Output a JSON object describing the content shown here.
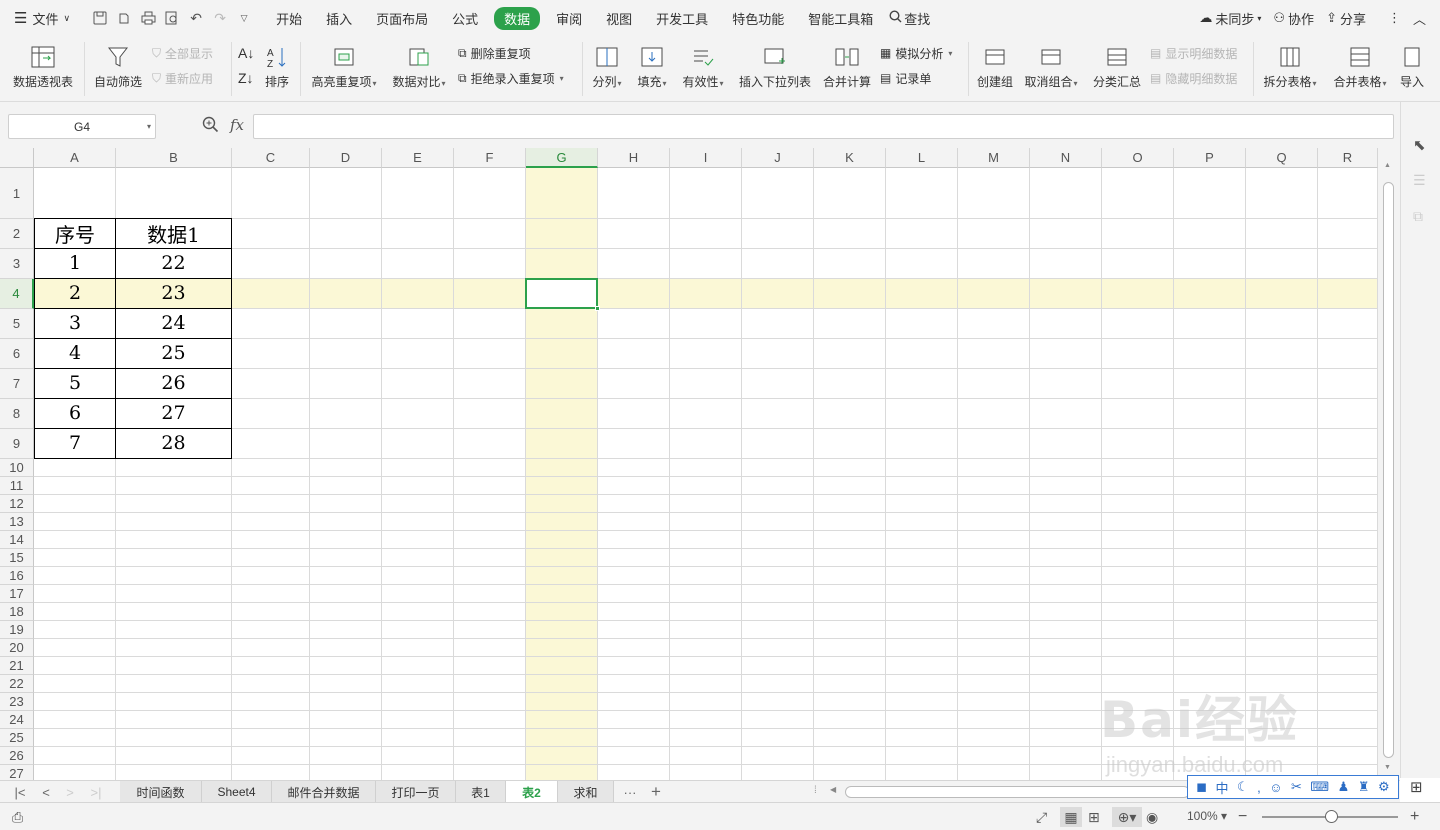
{
  "menubar": {
    "file_label": "文件",
    "tabs": [
      "开始",
      "插入",
      "页面布局",
      "公式",
      "数据",
      "审阅",
      "视图",
      "开发工具",
      "特色功能",
      "智能工具箱"
    ],
    "active_tab": "数据",
    "search_label": "查找",
    "sync_label": "未同步",
    "collab_label": "协作",
    "share_label": "分享"
  },
  "ribbon": {
    "pivot": "数据透视表",
    "autofilter": "自动筛选",
    "show_all": "全部显示",
    "reapply": "重新应用",
    "sort": "排序",
    "highlight_dup": "高亮重复项",
    "compare": "数据对比",
    "remove_dup": "删除重复项",
    "reject_dup": "拒绝录入重复项",
    "split": "分列",
    "fill": "填充",
    "validity": "有效性",
    "dropdown": "插入下拉列表",
    "consolidate": "合并计算",
    "simulate": "模拟分析",
    "record": "记录单",
    "group": "创建组",
    "ungroup": "取消组合",
    "subtotal": "分类汇总",
    "show_detail": "显示明细数据",
    "hide_detail": "隐藏明细数据",
    "split_table": "拆分表格",
    "merge_table": "合并表格",
    "import": "导入"
  },
  "formula_bar": {
    "name_box": "G4",
    "fx_label": "fx",
    "formula": ""
  },
  "grid": {
    "columns": [
      "A",
      "B",
      "C",
      "D",
      "E",
      "F",
      "G",
      "H",
      "I",
      "J",
      "K",
      "L",
      "M",
      "N",
      "O",
      "P",
      "Q",
      "R"
    ],
    "rows": [
      "1",
      "2",
      "3",
      "4",
      "5",
      "6",
      "7",
      "8",
      "9",
      "10",
      "11",
      "12",
      "13",
      "14",
      "15",
      "16",
      "17",
      "18",
      "19",
      "20",
      "21",
      "22",
      "23",
      "24",
      "25",
      "26",
      "27"
    ],
    "selected_cell": "G4",
    "table": {
      "headers": [
        "序号",
        "数据1"
      ],
      "rows": [
        [
          "1",
          "22"
        ],
        [
          "2",
          "23"
        ],
        [
          "3",
          "24"
        ],
        [
          "4",
          "25"
        ],
        [
          "5",
          "26"
        ],
        [
          "6",
          "27"
        ],
        [
          "7",
          "28"
        ]
      ]
    }
  },
  "sheets": {
    "tabs": [
      "时间函数",
      "Sheet4",
      "邮件合并数据",
      "打印一页",
      "表1",
      "表2",
      "求和"
    ],
    "active": "表2",
    "more": "···",
    "add": "+"
  },
  "status": {
    "zoom": "100%"
  },
  "watermark": {
    "brand": "Bai经验",
    "url": "jingyan.baidu.com"
  },
  "colors": {
    "accent": "#2ca14b",
    "highlight": "#fbf8d6"
  }
}
